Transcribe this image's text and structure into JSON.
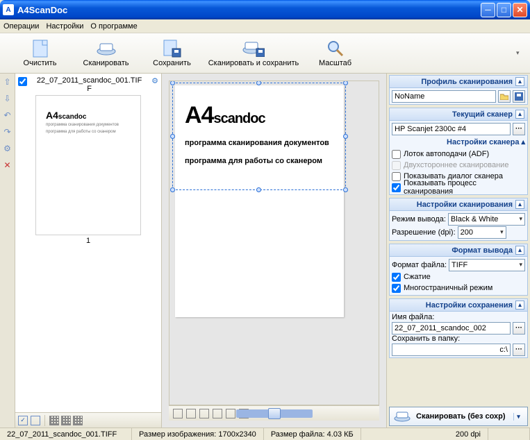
{
  "title": "A4ScanDoc",
  "menu": {
    "ops": "Операции",
    "settings": "Настройки",
    "about": "О программе"
  },
  "toolbar": {
    "clear": "Очистить",
    "scan": "Сканировать",
    "save": "Сохранить",
    "scan_save": "Сканировать и сохранить",
    "zoom": "Масштаб"
  },
  "thumb": {
    "filename_l1": "22_07_2011_scandoc_001.TIF",
    "filename_l2": "F",
    "page_num": "1",
    "logo_big": "A4",
    "logo_small": "scandoc",
    "logo_sub1": "программа сканирования документов",
    "logo_sub2": "программа для работы со сканером"
  },
  "preview": {
    "title_big": "A4",
    "title_small": "scandoc",
    "line1": "программа сканирования  документов",
    "line2": "программа для работы со сканером"
  },
  "panel": {
    "profile_h": "Профиль сканирования",
    "profile_name": "NoName",
    "scanner_h": "Текущий сканер",
    "scanner_name": "HP Scanjet 2300c #4",
    "scanner_opts_h": "Настройки сканера",
    "adf": "Лоток автоподачи (ADF)",
    "duplex": "Двухстороннее сканирование",
    "show_dialog": "Показывать диалог сканера",
    "show_process": "Показывать процесс сканирования",
    "scan_settings_h": "Настройки сканирования",
    "mode_lbl": "Режим вывода:",
    "mode_val": "Black & White",
    "dpi_lbl": "Разрешение (dpi):",
    "dpi_val": "200",
    "output_h": "Формат вывода",
    "fmt_lbl": "Формат файла:",
    "fmt_val": "TIFF",
    "compress": "Сжатие",
    "multipage": "Многостраничный режим",
    "save_h": "Настройки сохранения",
    "fname_lbl": "Имя файла:",
    "fname_val": "22_07_2011_scandoc_002",
    "folder_lbl": "Сохранить в папку:",
    "folder_val": "c:\\",
    "scan_btn": "Сканировать (без сохр)"
  },
  "status": {
    "file": "22_07_2011_scandoc_001.TIFF",
    "imgsize_lbl": "Размер изображения:",
    "imgsize_val": "1700x2340",
    "filesize_lbl": "Размер файла:",
    "filesize_val": "4.03 КБ",
    "dpi": "200 dpi"
  }
}
